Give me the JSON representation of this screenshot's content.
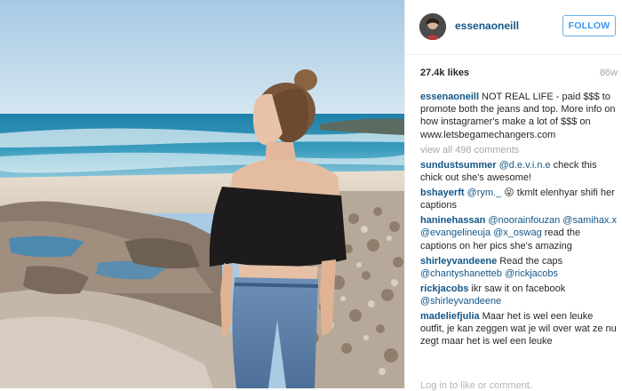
{
  "post": {
    "username": "essenaoneill",
    "follow_label": "FOLLOW",
    "likes": "27.4k likes",
    "age": "86w",
    "caption": {
      "user": "essenaoneill",
      "text": "NOT REAL LIFE - paid $$$ to promote both the jeans and top. More info on how instagramer's make a lot of $$$ on www.letsbegamechangers.com"
    },
    "view_all": "view all 498 comments",
    "comments": [
      {
        "user": "sundustsummer",
        "mention": "@d.e.v.i.n.e",
        "text": " check this chick out she's awesome!"
      },
      {
        "user": "bshayerft",
        "mention": "@rym._",
        "text": " 😝 tkmlt elenhyar shifi her captions"
      },
      {
        "user": "haninehassan",
        "mention": "@noorainfouzan @samihax.x @evangelineuja @x_oswag",
        "text": " read the captions on her pics she's amazing"
      },
      {
        "user": "shirleyvandeene",
        "mention": "",
        "text": "Read the caps @chantyshanetteb @rickjacobs"
      },
      {
        "user": "rickjacobs",
        "mention": "",
        "text": "ikr saw it on facebook @shirleyvandeene"
      },
      {
        "user": "madeliefjulia",
        "mention": "",
        "text": "Maar het is wel een leuke outfit, je kan zeggen wat je wil over wat ze nu zegt maar het is wel een leuke"
      }
    ],
    "add_comment_placeholder": "Log in to like or comment."
  },
  "colors": {
    "link_blue": "#125688",
    "follow_border": "#6bb1e3",
    "follow_text": "#3897f0",
    "muted": "#a5a7aa"
  }
}
